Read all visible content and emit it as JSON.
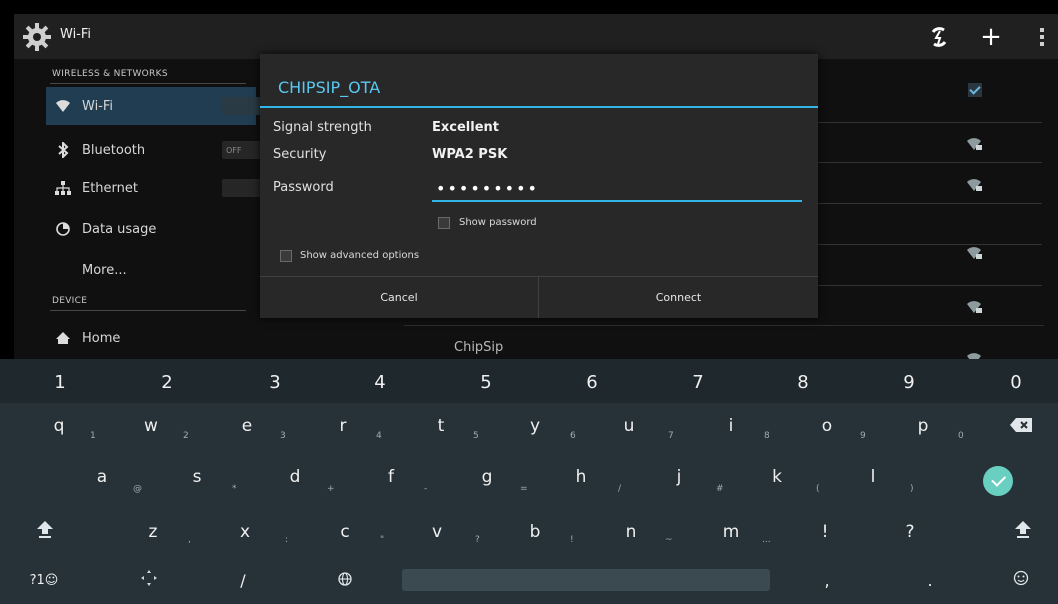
{
  "action_bar": {
    "title": "Wi-Fi",
    "icons": [
      "settings-gear-icon",
      "wps-icon",
      "add-icon",
      "overflow-menu-icon"
    ],
    "add_label": "+"
  },
  "settings": {
    "sections": [
      {
        "header": "WIRELESS & NETWORKS",
        "items": [
          {
            "label": "Wi-Fi",
            "icon": "wifi-icon",
            "toggle": "",
            "active": true
          },
          {
            "label": "Bluetooth",
            "icon": "bluetooth-icon",
            "toggle": "OFF",
            "active": false
          },
          {
            "label": "Ethernet",
            "icon": "ethernet-icon",
            "toggle": "",
            "active": false
          },
          {
            "label": "Data usage",
            "icon": "data-usage-icon",
            "toggle": "",
            "active": false
          },
          {
            "label": "More...",
            "icon": "",
            "toggle": "",
            "active": false
          }
        ]
      },
      {
        "header": "DEVICE",
        "items": [
          {
            "label": "Home",
            "icon": "home-icon",
            "toggle": "",
            "active": false
          }
        ]
      }
    ],
    "network_background_label": "ChipSip"
  },
  "dialog": {
    "title": "CHIPSIP_OTA",
    "signal_label": "Signal strength",
    "signal_value": "Excellent",
    "security_label": "Security",
    "security_value": "WPA2 PSK",
    "password_label": "Password",
    "password_value": "•••••••••",
    "show_password_label": "Show password",
    "show_advanced_label": "Show advanced options",
    "cancel_label": "Cancel",
    "connect_label": "Connect"
  },
  "keyboard": {
    "numbers": [
      "1",
      "2",
      "3",
      "4",
      "5",
      "6",
      "7",
      "8",
      "9",
      "0"
    ],
    "row1": [
      {
        "key": "q",
        "hint": "1"
      },
      {
        "key": "w",
        "hint": "2"
      },
      {
        "key": "e",
        "hint": "3"
      },
      {
        "key": "r",
        "hint": "4"
      },
      {
        "key": "t",
        "hint": "5"
      },
      {
        "key": "y",
        "hint": "6"
      },
      {
        "key": "u",
        "hint": "7"
      },
      {
        "key": "i",
        "hint": "8"
      },
      {
        "key": "o",
        "hint": "9"
      },
      {
        "key": "p",
        "hint": "0"
      }
    ],
    "row2": [
      {
        "key": "a",
        "hint": "@"
      },
      {
        "key": "s",
        "hint": "*"
      },
      {
        "key": "d",
        "hint": "+"
      },
      {
        "key": "f",
        "hint": "-"
      },
      {
        "key": "g",
        "hint": "="
      },
      {
        "key": "h",
        "hint": "/"
      },
      {
        "key": "j",
        "hint": "#"
      },
      {
        "key": "k",
        "hint": "("
      },
      {
        "key": "l",
        "hint": ")"
      }
    ],
    "row3": [
      {
        "key": "z",
        "hint": ","
      },
      {
        "key": "x",
        "hint": ":"
      },
      {
        "key": "c",
        "hint": "\""
      },
      {
        "key": "v",
        "hint": "?"
      },
      {
        "key": "b",
        "hint": "!"
      },
      {
        "key": "n",
        "hint": "~"
      },
      {
        "key": "m",
        "hint": "..."
      },
      {
        "key": "!",
        "hint": ""
      },
      {
        "key": "?",
        "hint": ""
      }
    ],
    "bottom": {
      "symbols_label": "?1☺",
      "slash_label": "/",
      "comma_label": ",",
      "period_label": "."
    },
    "icons": [
      "backspace-icon",
      "enter-icon",
      "shift-icon",
      "cursor-move-icon",
      "globe-icon",
      "emoji-icon"
    ],
    "accent_color": "#69d0c1"
  }
}
